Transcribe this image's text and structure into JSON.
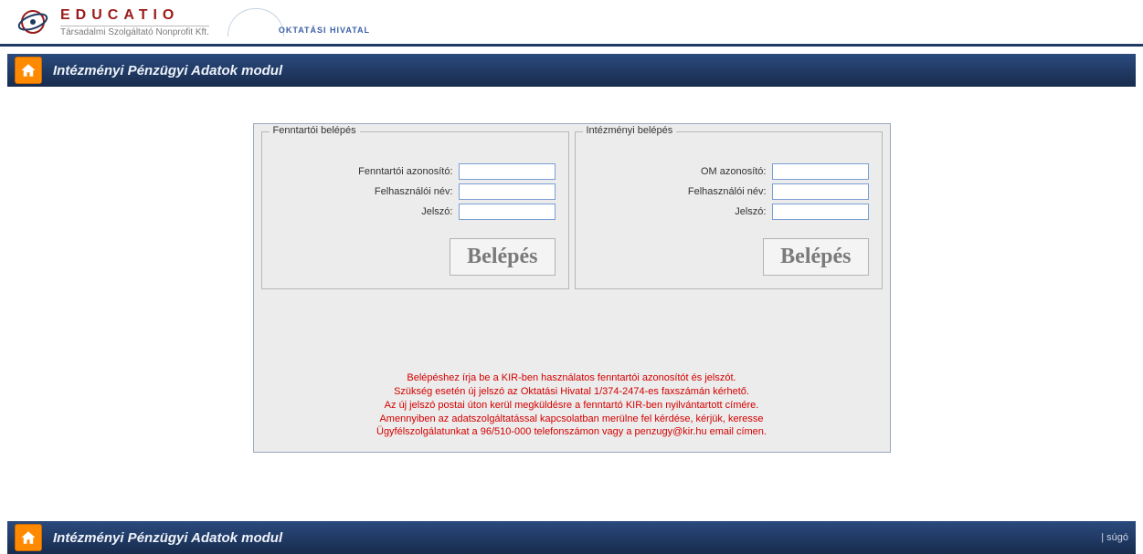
{
  "brand": {
    "name": "EDUCATIO",
    "sub": "Társadalmi Szolgáltató Nonprofit Kft.",
    "partner": "OKTATÁSI HIVATAL"
  },
  "nav": {
    "title": "Intézményi Pénzügyi Adatok modul"
  },
  "login": {
    "left": {
      "legend": "Fenntartói belépés",
      "id_label": "Fenntartói azonosító:",
      "user_label": "Felhasználói név:",
      "pass_label": "Jelszó:",
      "submit": "Belépés"
    },
    "right": {
      "legend": "Intézményi belépés",
      "id_label": "OM azonosító:",
      "user_label": "Felhasználói név:",
      "pass_label": "Jelszó:",
      "submit": "Belépés"
    }
  },
  "help": {
    "l1": "Belépéshez írja be a KIR-ben használatos fenntartói azonosítót és jelszót.",
    "l2": "Szükség esetén új jelszó az Oktatási Hivatal 1/374-2474-es faxszámán kérhető.",
    "l3": "Az új jelszó postai úton kerül megküldésre a fenntartó KIR-ben nyilvántartott címére.",
    "l4": "Amennyiben az adatszolgáltatással kapcsolatban merülne fel kérdése, kérjük, keresse",
    "l5": "Ügyfélszolgálatunkat a 96/510-000 telefonszámon vagy a penzugy@kir.hu email címen."
  },
  "footer": {
    "title": "Intézményi Pénzügyi Adatok modul",
    "help": "| súgó"
  }
}
